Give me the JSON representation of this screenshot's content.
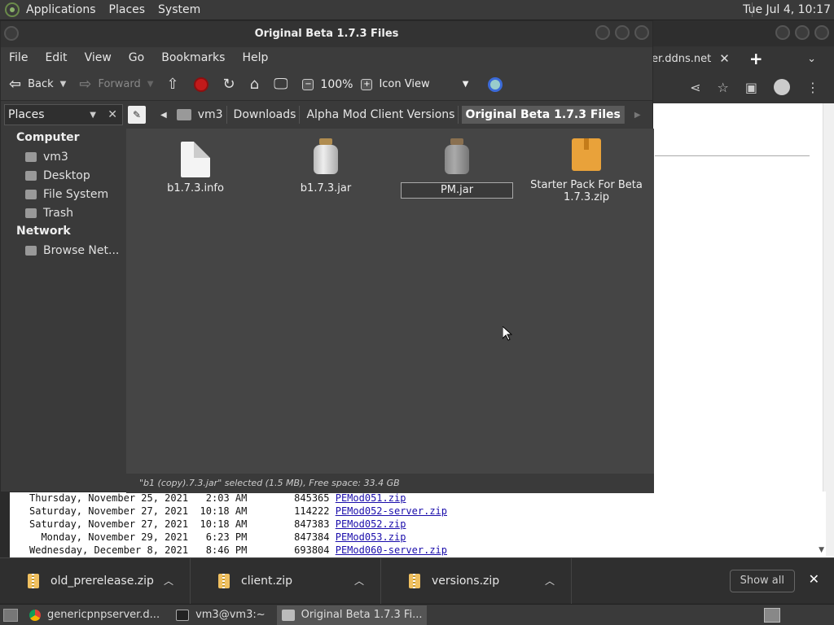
{
  "top_panel": {
    "menus": [
      "Applications",
      "Places",
      "System"
    ],
    "clock": "Tue Jul  4, 10:17"
  },
  "browser": {
    "tab_text": "er.ddns.net",
    "listing": [
      {
        "date": "Thursday, November 25, 2021",
        "time": "2:03 AM",
        "size": "845365",
        "file": "PEMod051.zip"
      },
      {
        "date": "Saturday, November 27, 2021",
        "time": "10:18 AM",
        "size": "114222",
        "file": "PEMod052-server.zip"
      },
      {
        "date": "Saturday, November 27, 2021",
        "time": "10:18 AM",
        "size": "847383",
        "file": "PEMod052.zip"
      },
      {
        "date": "Monday, November 29, 2021",
        "time": "6:23 PM",
        "size": "847384",
        "file": "PEMod053.zip"
      },
      {
        "date": "Wednesday, December 8, 2021",
        "time": "8:46 PM",
        "size": "693804",
        "file": "PEMod060-server.zip"
      }
    ]
  },
  "downloads": {
    "items": [
      "old_prerelease.zip",
      "client.zip",
      "versions.zip"
    ],
    "show_all": "Show all"
  },
  "taskbar": {
    "tasks": [
      "genericpnpserver.d...",
      "vm3@vm3:~",
      "Original Beta 1.7.3 Fi..."
    ]
  },
  "file_manager": {
    "title": "Original Beta 1.7.3 Files",
    "menus": [
      "File",
      "Edit",
      "View",
      "Go",
      "Bookmarks",
      "Help"
    ],
    "toolbar": {
      "back": "Back",
      "forward": "Forward",
      "zoom": "100%",
      "view_mode": "Icon View"
    },
    "side_header": "Places",
    "breadcrumbs": [
      "vm3",
      "Downloads",
      "Alpha Mod Client Versions",
      "Original Beta 1.7.3 Files"
    ],
    "sidebar": {
      "computer_header": "Computer",
      "computer_items": [
        "vm3",
        "Desktop",
        "File System",
        "Trash"
      ],
      "network_header": "Network",
      "network_items": [
        "Browse Net..."
      ]
    },
    "files": [
      {
        "name": "b1.7.3.info",
        "icon": "document-icon"
      },
      {
        "name": "b1.7.3.jar",
        "icon": "jar-icon"
      },
      {
        "name": "PM.jar",
        "icon": "jar-icon",
        "renaming": true
      },
      {
        "name_line1": "Starter Pack For Beta",
        "name_line2": "1.7.3.zip",
        "icon": "zip-icon"
      }
    ],
    "status": "\"b1 (copy).7.3.jar\" selected (1.5 MB), Free space: 33.4 GB"
  }
}
